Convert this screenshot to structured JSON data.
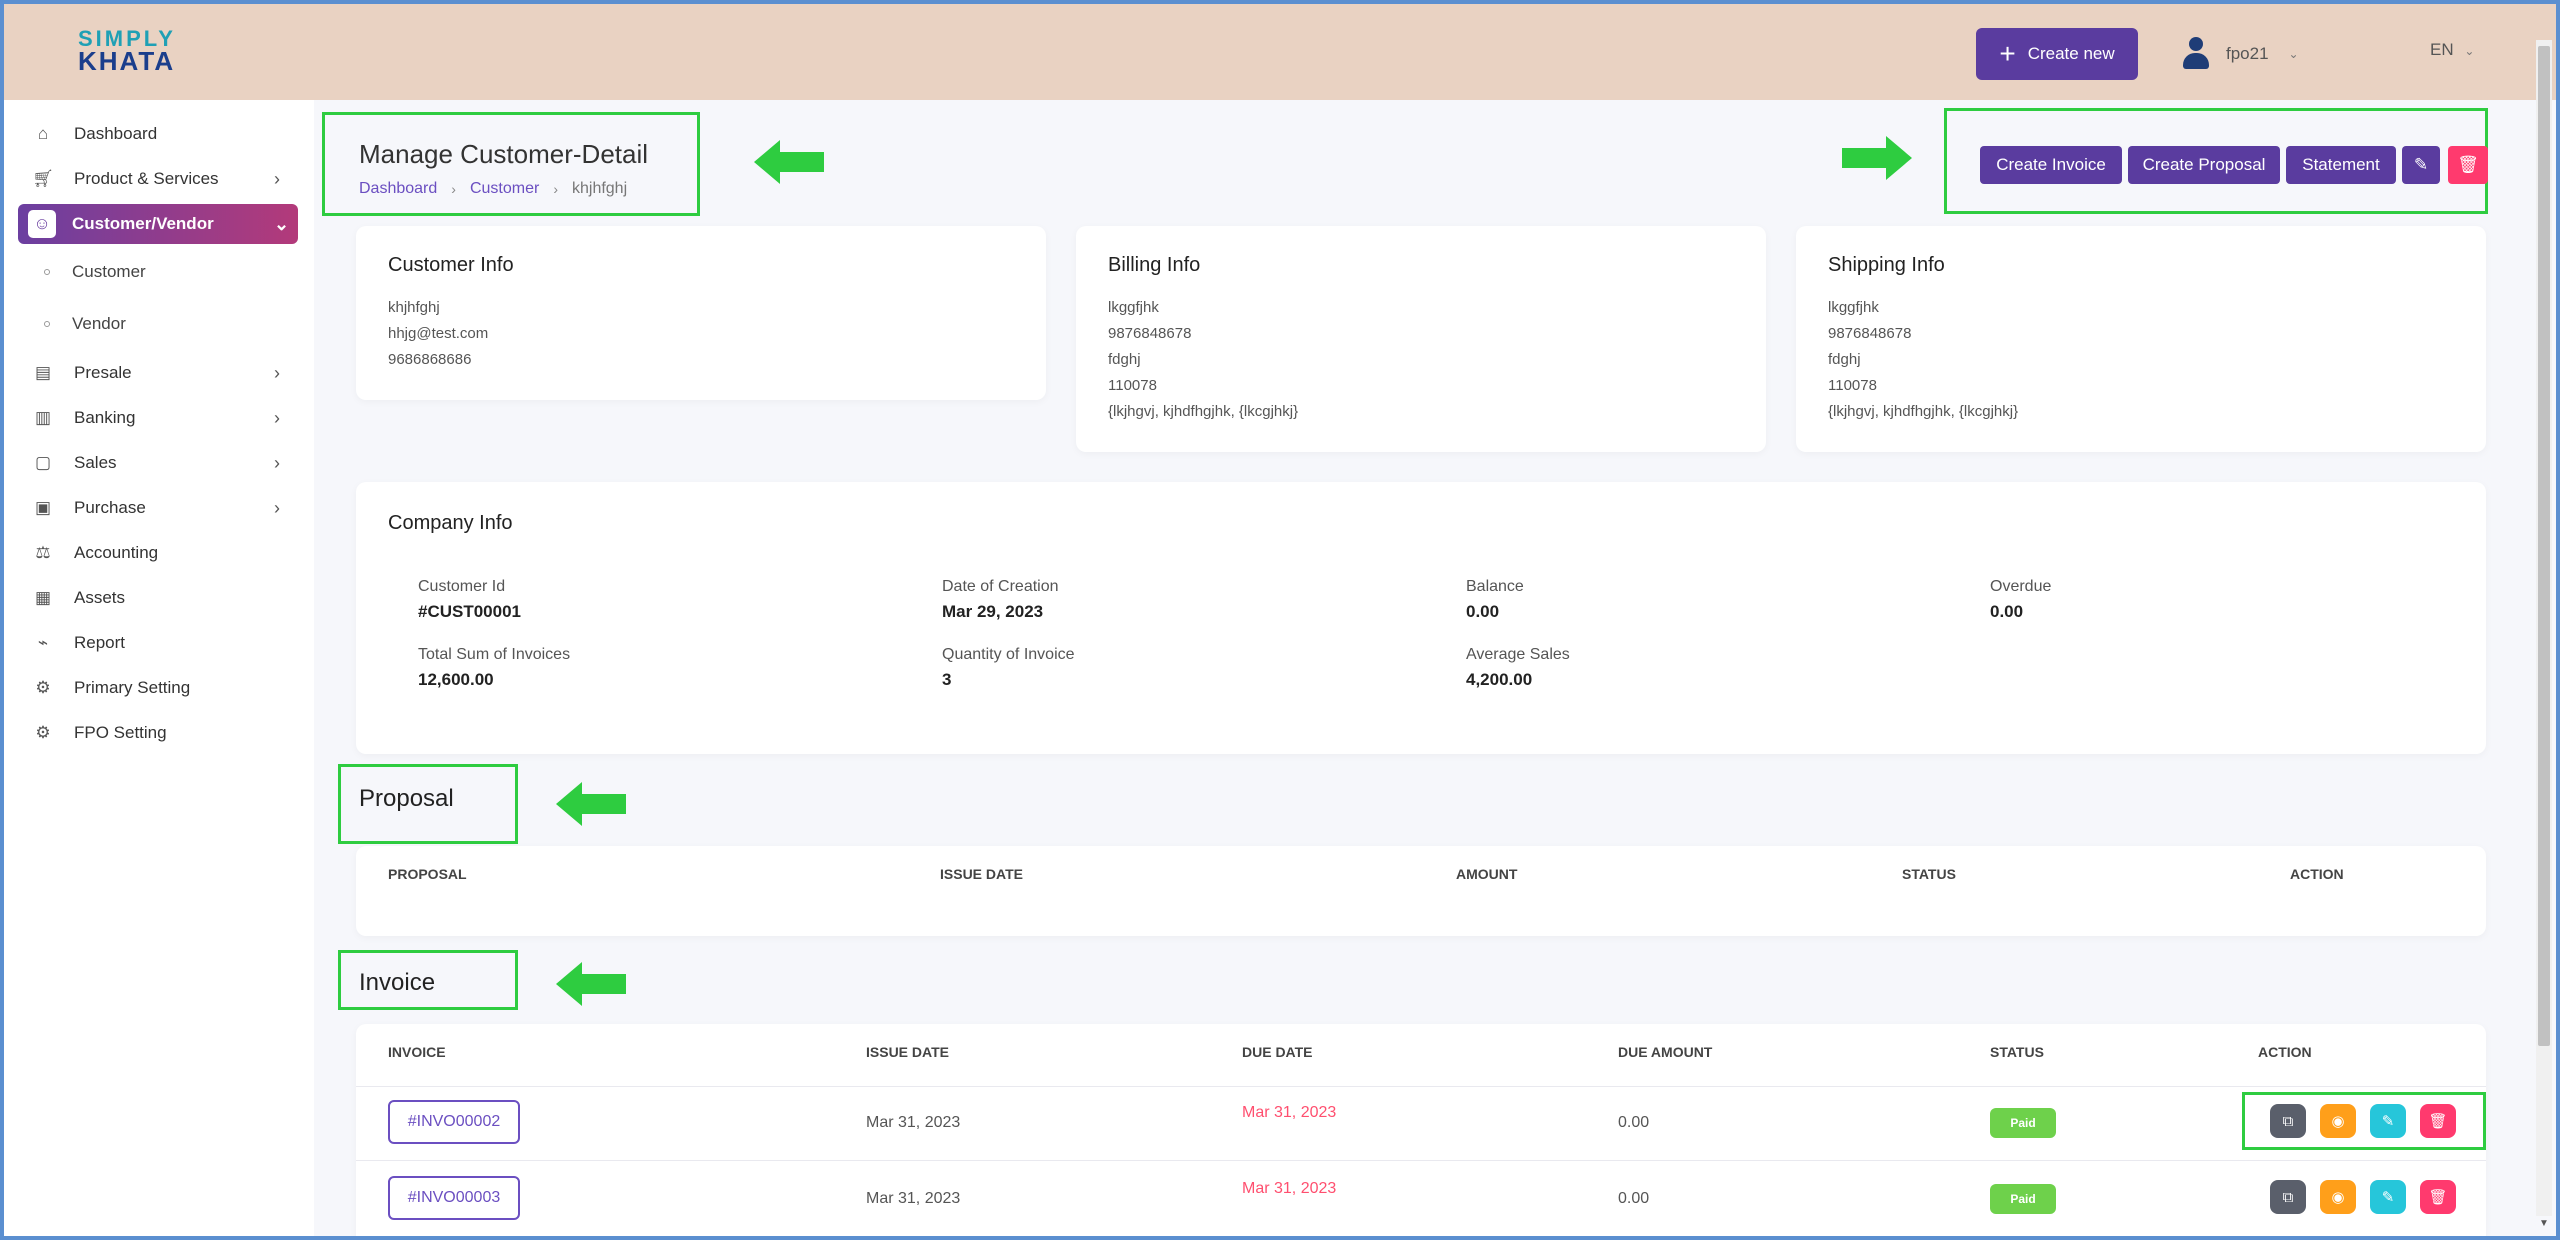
{
  "app": {
    "logo_top": "SIMPLY",
    "logo_bottom": "KHATA",
    "create_new": "Create new",
    "user_name": "fpo21",
    "language": "EN"
  },
  "sidebar": {
    "items": [
      {
        "label": "Dashboard",
        "icon": "home-icon"
      },
      {
        "label": "Product & Services",
        "icon": "cart-icon"
      },
      {
        "label": "Customer/Vendor",
        "icon": "users-icon"
      },
      {
        "label": "Presale",
        "icon": "building-icon"
      },
      {
        "label": "Banking",
        "icon": "bank-icon"
      },
      {
        "label": "Sales",
        "icon": "file-icon"
      },
      {
        "label": "Purchase",
        "icon": "clipboard-icon"
      },
      {
        "label": "Accounting",
        "icon": "scale-icon"
      },
      {
        "label": "Assets",
        "icon": "calculator-icon"
      },
      {
        "label": "Report",
        "icon": "chart-icon"
      },
      {
        "label": "Primary Setting",
        "icon": "settings-icon"
      },
      {
        "label": "FPO Setting",
        "icon": "gear-icon"
      }
    ],
    "subitems": [
      "Customer",
      "Vendor"
    ]
  },
  "header": {
    "title": "Manage Customer-Detail",
    "breadcrumb": [
      "Dashboard",
      "Customer",
      "khjhfghj"
    ]
  },
  "actions": {
    "create_invoice": "Create Invoice",
    "create_proposal": "Create Proposal",
    "statement": "Statement"
  },
  "customer_info": {
    "title": "Customer Info",
    "lines": [
      "khjhfghj",
      "hhjg@test.com",
      "9686868686"
    ]
  },
  "billing_info": {
    "title": "Billing Info",
    "lines": [
      "lkggfjhk",
      "9876848678",
      "fdghj",
      "110078",
      "{lkjhgvj, kjhdfhgjhk, {lkcgjhkj}"
    ]
  },
  "shipping_info": {
    "title": "Shipping Info",
    "lines": [
      "lkggfjhk",
      "9876848678",
      "fdghj",
      "110078",
      "{lkjhgvj, kjhdfhgjhk, {lkcgjhkj}"
    ]
  },
  "company_info": {
    "title": "Company Info",
    "stats": [
      {
        "label": "Customer Id",
        "value": "#CUST00001"
      },
      {
        "label": "Date of Creation",
        "value": "Mar 29, 2023"
      },
      {
        "label": "Balance",
        "value": "0.00"
      },
      {
        "label": "Overdue",
        "value": "0.00"
      },
      {
        "label": "Total Sum of Invoices",
        "value": "12,600.00"
      },
      {
        "label": "Quantity of Invoice",
        "value": "3"
      },
      {
        "label": "Average Sales",
        "value": "4,200.00"
      }
    ]
  },
  "proposal": {
    "title": "Proposal",
    "columns": [
      "PROPOSAL",
      "ISSUE DATE",
      "AMOUNT",
      "STATUS",
      "ACTION"
    ]
  },
  "invoice": {
    "title": "Invoice",
    "columns": [
      "INVOICE",
      "ISSUE DATE",
      "DUE DATE",
      "DUE AMOUNT",
      "STATUS",
      "ACTION"
    ],
    "rows": [
      {
        "id": "#INVO00002",
        "issue_date": "Mar 31, 2023",
        "due_date": "Mar 31, 2023",
        "due_amount": "0.00",
        "status": "Paid"
      },
      {
        "id": "#INVO00003",
        "issue_date": "Mar 31, 2023",
        "due_date": "Mar 31, 2023",
        "due_amount": "0.00",
        "status": "Paid"
      }
    ]
  },
  "colors": {
    "primary": "#5a3c9f",
    "danger": "#ff3a6e",
    "annotation": "#2ecc40",
    "header_bg": "#e9d2c2"
  }
}
